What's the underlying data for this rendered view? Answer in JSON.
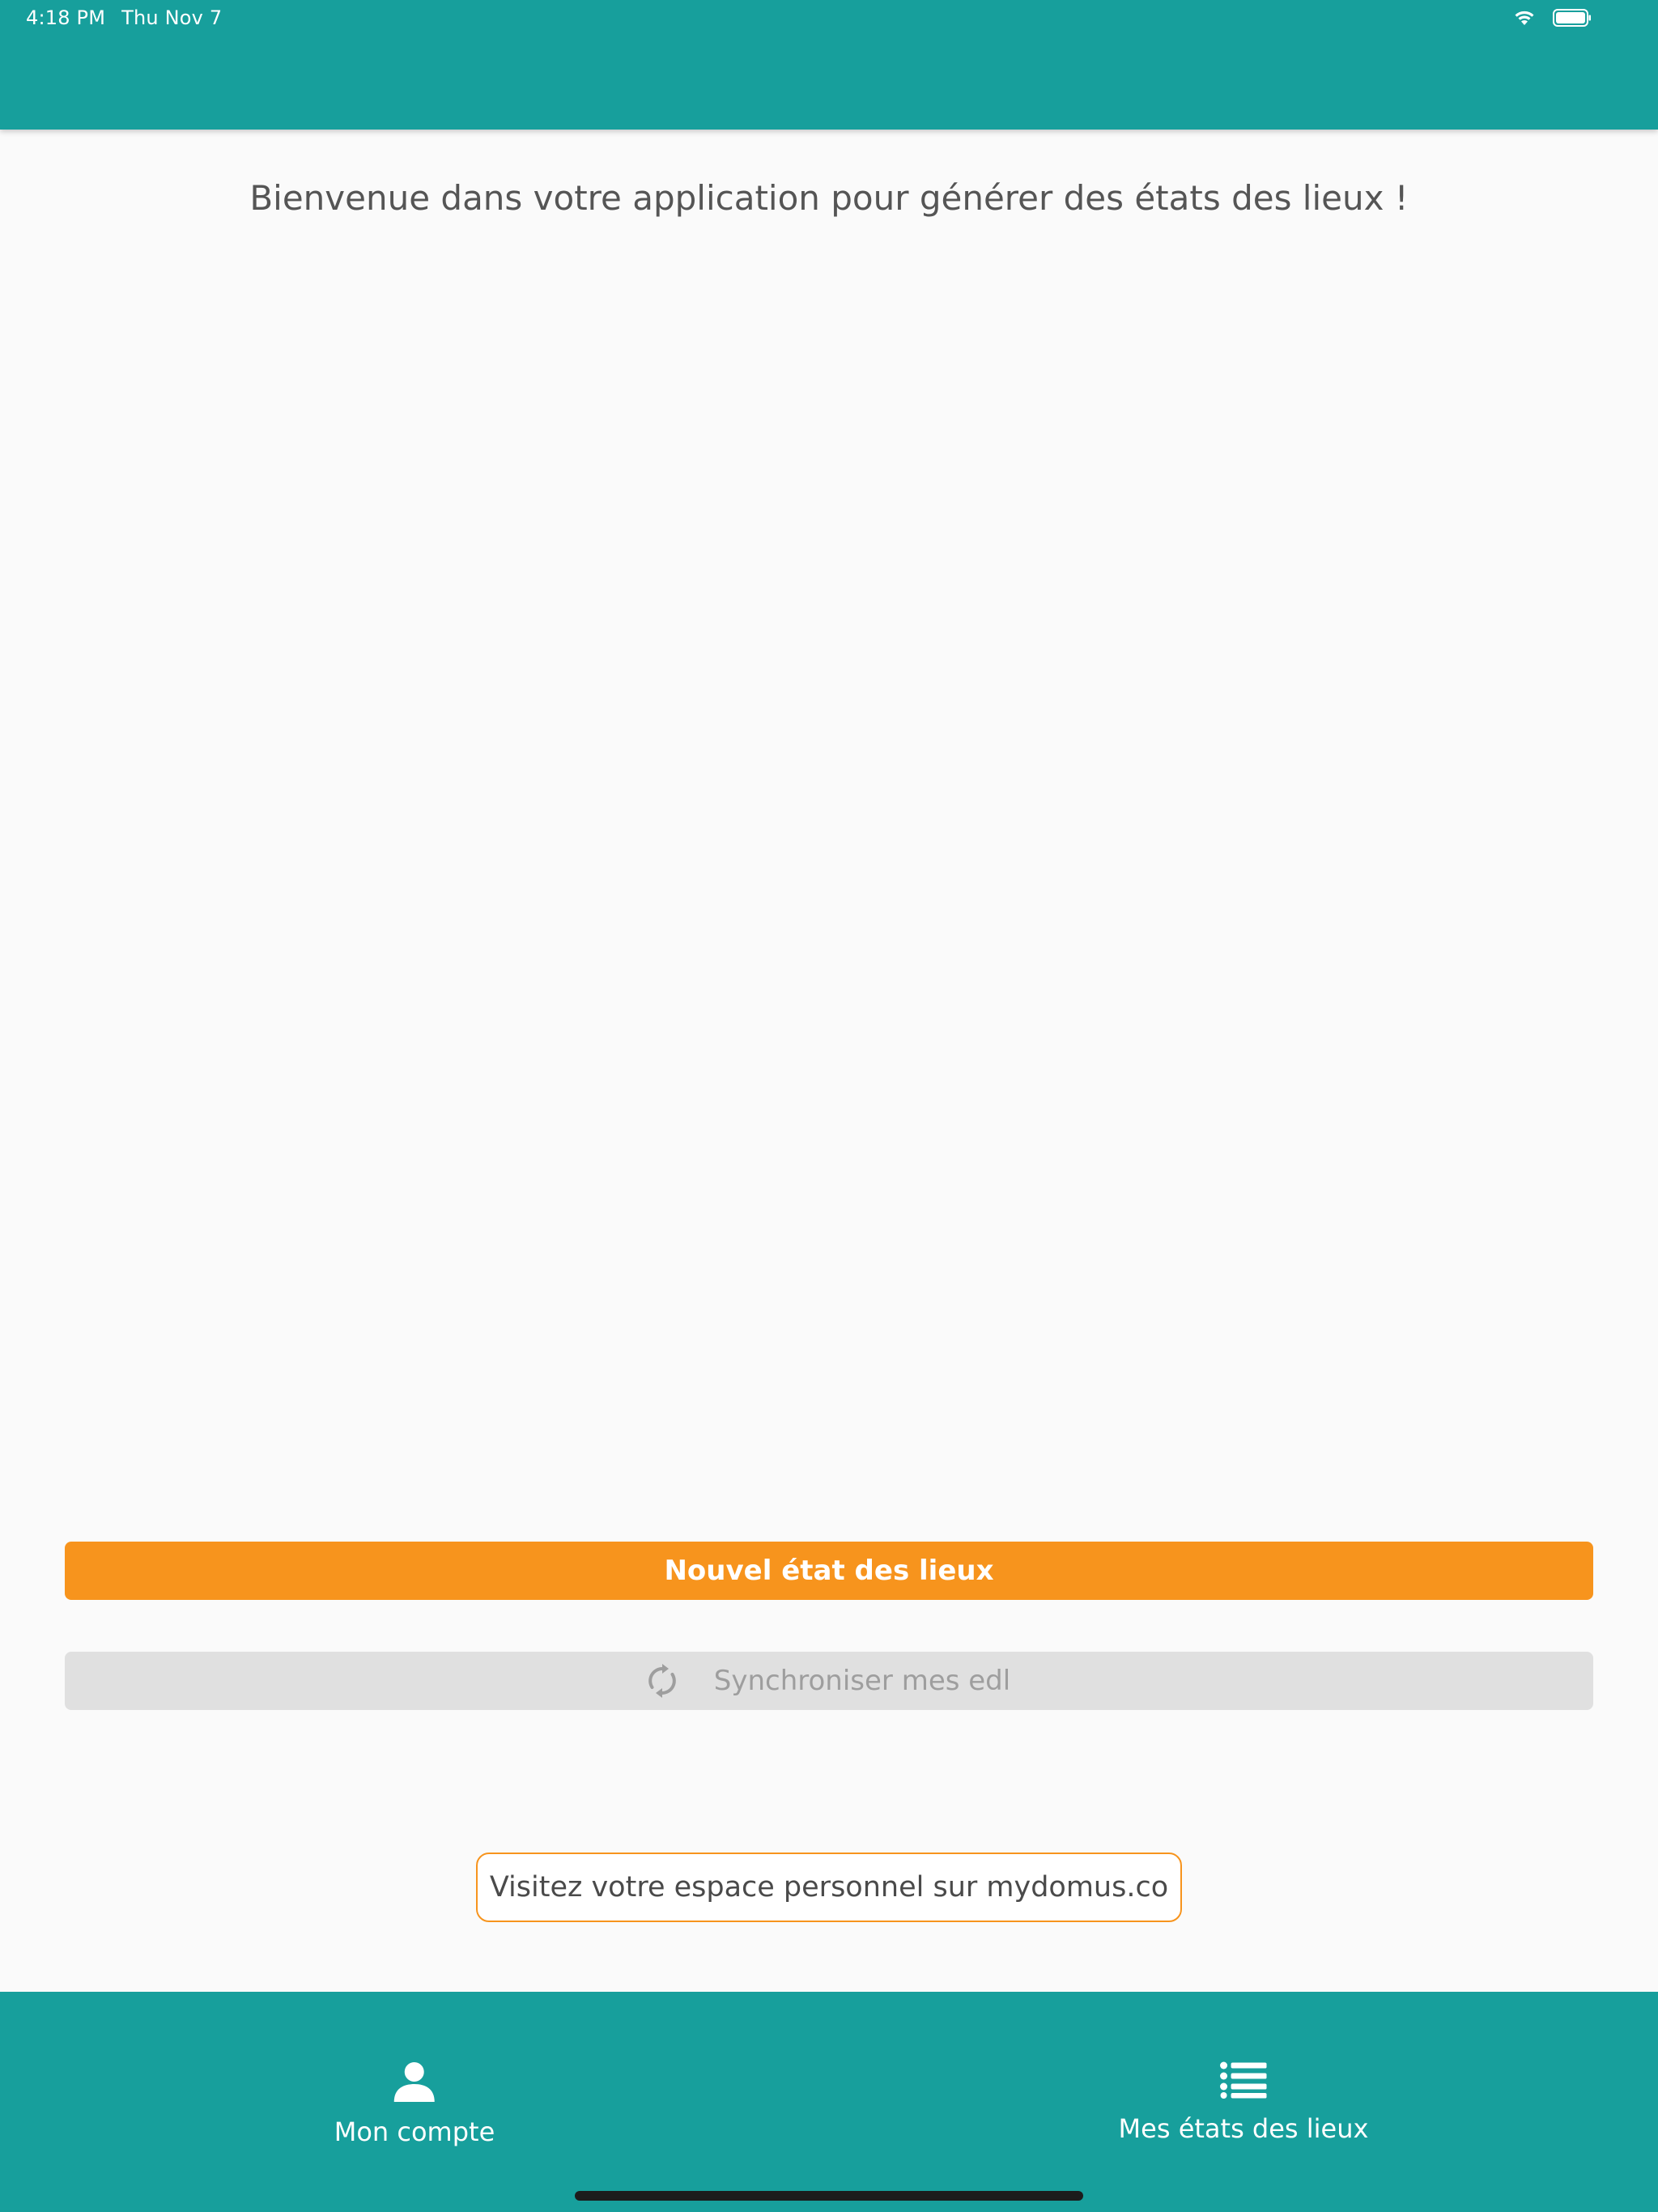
{
  "status_bar": {
    "time": "4:18 PM",
    "date": "Thu Nov 7",
    "wifi_icon": "wifi-icon",
    "battery_icon": "battery-icon"
  },
  "colors": {
    "primary_teal": "#179f9c",
    "accent_orange": "#f7941d",
    "disabled_gray": "#e0e0e0"
  },
  "main": {
    "welcome_text": "Bienvenue dans votre application pour générer des états des lieux !",
    "new_button_label": "Nouvel état des lieux",
    "sync_button_label": "Synchroniser mes edl",
    "sync_icon": "sync-icon",
    "visit_button_label": "Visitez votre espace personnel sur mydomus.co"
  },
  "bottom_nav": {
    "items": [
      {
        "label": "Mon compte",
        "icon": "person-icon"
      },
      {
        "label": "Mes états des lieux",
        "icon": "list-icon"
      }
    ]
  }
}
